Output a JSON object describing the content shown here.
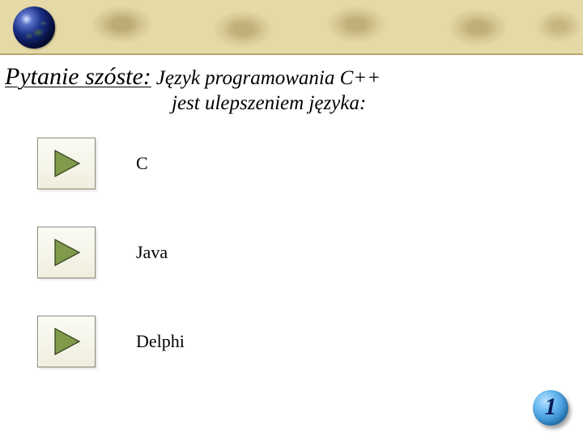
{
  "question": {
    "title": "Pytanie szóste:",
    "body_line1": "Język programowania C++",
    "body_line2": "jest ulepszeniem języka:"
  },
  "answers": [
    {
      "label": "C"
    },
    {
      "label": "Java"
    },
    {
      "label": "Delphi"
    }
  ],
  "slide_number": "1",
  "icons": {
    "play": "play-icon",
    "globe": "globe-icon"
  },
  "colors": {
    "banner_bg": "#e6d9a8",
    "triangle_fill": "#7e9a4a",
    "triangle_stroke": "#2e3a18",
    "slide_disc": "#2f86c9"
  }
}
